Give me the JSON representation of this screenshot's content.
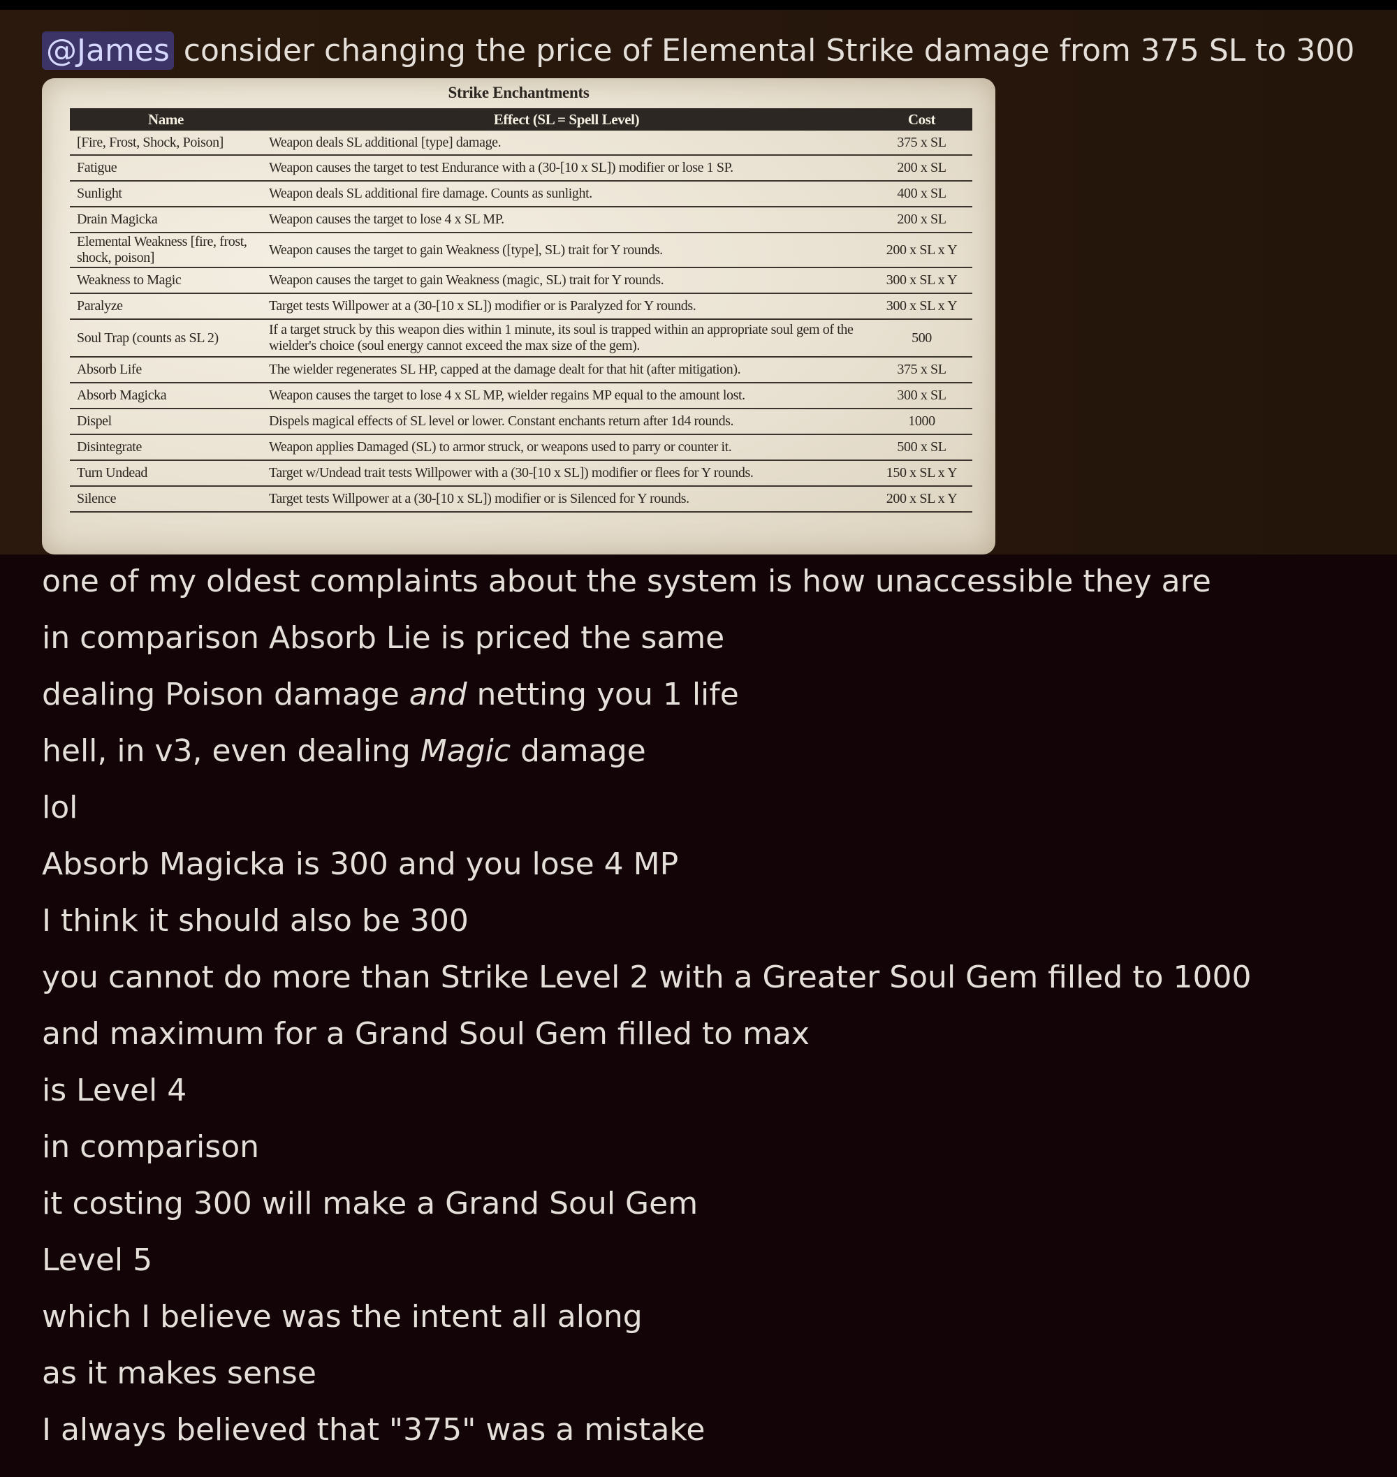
{
  "first_message": {
    "mention": "@James",
    "text": "consider changing the price of Elemental Strike damage from 375 SL to 300"
  },
  "attachment": {
    "title": "Strike Enchantments",
    "columns": [
      "Name",
      "Effect (SL = Spell Level)",
      "Cost"
    ],
    "rows": [
      {
        "name": "[Fire, Frost, Shock, Poison]",
        "effect": "Weapon deals SL additional [type] damage.",
        "cost": "375 x SL"
      },
      {
        "name": "Fatigue",
        "effect": "Weapon causes the target to test Endurance with a (30-[10 x SL]) modifier or lose 1 SP.",
        "cost": "200 x SL"
      },
      {
        "name": "Sunlight",
        "effect": "Weapon deals SL additional fire damage. Counts as sunlight.",
        "cost": "400 x SL"
      },
      {
        "name": "Drain Magicka",
        "effect": "Weapon causes the target to lose 4 x SL MP.",
        "cost": "200 x SL"
      },
      {
        "name": "Elemental Weakness [fire, frost, shock, poison]",
        "effect": "Weapon causes the target to gain Weakness ([type], SL) trait for Y rounds.",
        "cost": "200 x SL x Y"
      },
      {
        "name": "Weakness to Magic",
        "effect": "Weapon causes the target to gain Weakness (magic, SL) trait for Y rounds.",
        "cost": "300 x SL x Y"
      },
      {
        "name": "Paralyze",
        "effect": "Target tests Willpower at a (30-[10 x SL]) modifier or is Paralyzed for Y rounds.",
        "cost": "300 x SL x Y"
      },
      {
        "name": "Soul Trap (counts as SL 2)",
        "effect": "If a target struck by this weapon dies within 1 minute, its soul is trapped within an appropriate soul gem of the wielder's choice (soul energy cannot exceed the max size of the gem).",
        "cost": "500"
      },
      {
        "name": "Absorb Life",
        "effect": "The wielder regenerates SL HP, capped at the damage dealt for that hit (after mitigation).",
        "cost": "375 x SL"
      },
      {
        "name": "Absorb Magicka",
        "effect": "Weapon causes the target to lose 4 x SL MP, wielder regains MP equal to the amount lost.",
        "cost": "300 x SL"
      },
      {
        "name": "Dispel",
        "effect": "Dispels magical effects of SL level or lower. Constant enchants return after 1d4 rounds.",
        "cost": "1000"
      },
      {
        "name": "Disintegrate",
        "effect": "Weapon applies Damaged (SL) to armor struck, or weapons used to parry or counter it.",
        "cost": "500 x SL"
      },
      {
        "name": "Turn Undead",
        "effect": "Target w/Undead trait tests Willpower with a (30-[10 x SL]) modifier or flees for Y rounds.",
        "cost": "150 x SL x Y"
      },
      {
        "name": "Silence",
        "effect": "Target tests Willpower at a (30-[10 x SL]) modifier or is Silenced for Y rounds.",
        "cost": "200 x SL x Y"
      }
    ]
  },
  "messages": [
    "one of my oldest complaints about the system is how unaccessible they are",
    "in comparison Absorb Lie is priced the same",
    {
      "before": "dealing Poison damage ",
      "em": "and",
      "after": " netting you 1 life"
    },
    {
      "before": "hell, in v3, even dealing ",
      "em": "Magic",
      "after": " damage"
    },
    "lol",
    "Absorb Magicka is 300 and you lose 4 MP",
    "I think it should also be 300",
    "you cannot do more than Strike Level 2 with a Greater Soul Gem filled to 1000",
    "and maximum for a Grand Soul Gem filled to max",
    "is Level 4",
    "in comparison",
    "it costing 300 will make a Grand Soul Gem",
    "Level 5",
    "which I believe was the intent all along",
    "as it makes sense",
    "I always believed that \"375\" was a mistake"
  ]
}
